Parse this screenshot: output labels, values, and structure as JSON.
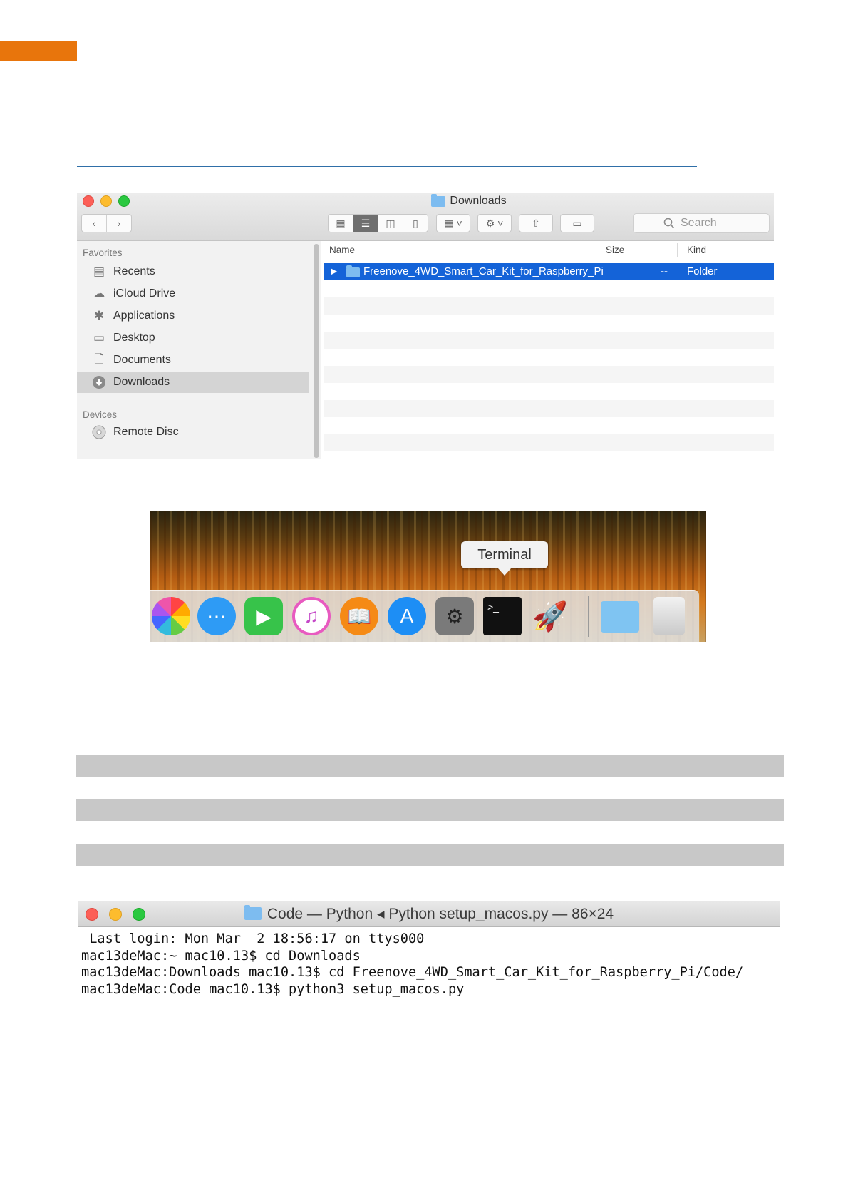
{
  "finder": {
    "title": "Downloads",
    "search_placeholder": "Search",
    "sidebar": {
      "favorites_heading": "Favorites",
      "items": [
        {
          "label": "Recents",
          "icon": "recents-icon"
        },
        {
          "label": "iCloud Drive",
          "icon": "cloud-icon"
        },
        {
          "label": "Applications",
          "icon": "applications-icon"
        },
        {
          "label": "Desktop",
          "icon": "desktop-icon"
        },
        {
          "label": "Documents",
          "icon": "documents-icon"
        },
        {
          "label": "Downloads",
          "icon": "downloads-icon",
          "selected": true
        }
      ],
      "devices_heading": "Devices",
      "devices": [
        {
          "label": "Remote Disc",
          "icon": "disc-icon"
        }
      ]
    },
    "columns": {
      "name": "Name",
      "size": "Size",
      "kind": "Kind"
    },
    "rows": [
      {
        "name": "Freenove_4WD_Smart_Car_Kit_for_Raspberry_Pi",
        "size": "--",
        "kind": "Folder"
      }
    ]
  },
  "dock": {
    "tooltip": "Terminal",
    "apps": [
      "Photos",
      "Messages",
      "FaceTime",
      "iTunes",
      "iBooks",
      "App Store",
      "System Preferences",
      "Terminal",
      "Python Launcher",
      "Folder",
      "Trash"
    ]
  },
  "terminal": {
    "title": "Code — Python ◂ Python setup_macos.py — 86×24",
    "lines": [
      " Last login: Mon Mar  2 18:56:17 on ttys000",
      "mac13deMac:~ mac10.13$ cd Downloads",
      "mac13deMac:Downloads mac10.13$ cd Freenove_4WD_Smart_Car_Kit_for_Raspberry_Pi/Code/",
      "mac13deMac:Code mac10.13$ python3 setup_macos.py"
    ]
  },
  "colors": {
    "accent_orange": "#e8750c",
    "selection_blue": "#1463d8",
    "rule_blue": "#2f6fa8"
  }
}
